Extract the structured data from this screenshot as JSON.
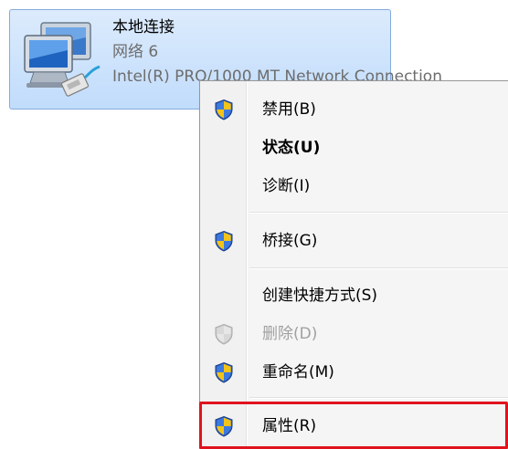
{
  "connection": {
    "name": "本地连接",
    "network": "网络  6",
    "adapter": "Intel(R) PRO/1000 MT Network Connection",
    "icon": "network-adapter-icon"
  },
  "context_menu": {
    "items": [
      {
        "label": "禁用(B)",
        "icon": "uac-shield-icon"
      },
      {
        "label": "状态(U)",
        "default": true
      },
      {
        "label": "诊断(I)"
      },
      {
        "label": "桥接(G)",
        "icon": "uac-shield-icon"
      },
      {
        "label": "创建快捷方式(S)"
      },
      {
        "label": "删除(D)",
        "icon": "uac-shield-icon",
        "disabled": true
      },
      {
        "label": "重命名(M)",
        "icon": "uac-shield-icon"
      },
      {
        "label": "属性(R)",
        "icon": "uac-shield-icon",
        "highlighted": true
      }
    ]
  },
  "colors": {
    "highlight": "#e0131e",
    "selection": "#c1dcfc",
    "shield_blue": "#2d63c4",
    "shield_yellow": "#f3c318"
  }
}
